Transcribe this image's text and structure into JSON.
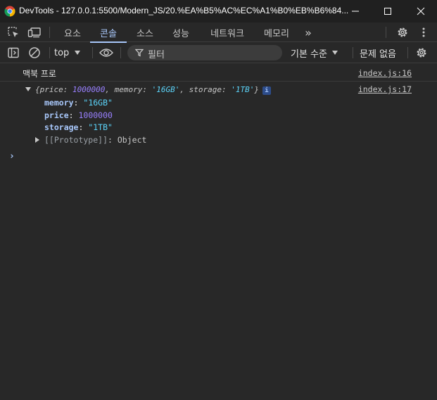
{
  "window": {
    "app_name": "DevTools",
    "url": "127.0.0.1:5500/Modern_JS/20.%EA%B5%AC%EC%A1%B0%EB%B6%84..."
  },
  "tabs": {
    "items": [
      {
        "label": "요소"
      },
      {
        "label": "콘솔"
      },
      {
        "label": "소스"
      },
      {
        "label": "성능"
      },
      {
        "label": "네트워크"
      },
      {
        "label": "메모리"
      }
    ],
    "active_index": 1,
    "more_symbol": "»"
  },
  "toolbar": {
    "context": "top",
    "filter_placeholder": "필터",
    "levels": "기본 수준",
    "issues": "문제 없음"
  },
  "console": {
    "log_message": "맥북 프로",
    "source_1": "index.js:16",
    "source_2": "index.js:17",
    "object_preview": {
      "open": "{",
      "k1": "price",
      "v1": "1000000",
      "k2": "memory",
      "v2": "'16GB'",
      "k3": "storage",
      "v3": "'1TB'",
      "close": "}",
      "info": "i"
    },
    "properties": [
      {
        "key": "memory",
        "value": "\"16GB\""
      },
      {
        "key": "price",
        "value": "1000000"
      },
      {
        "key": "storage",
        "value": "\"1TB\""
      }
    ],
    "prototype_label": "[[Prototype]]",
    "prototype_value": "Object",
    "prompt_symbol": "›"
  },
  "colors": {
    "accent": "#a8c7fa",
    "number": "#9980ff",
    "string": "#5cd5fb",
    "background": "#282828"
  }
}
